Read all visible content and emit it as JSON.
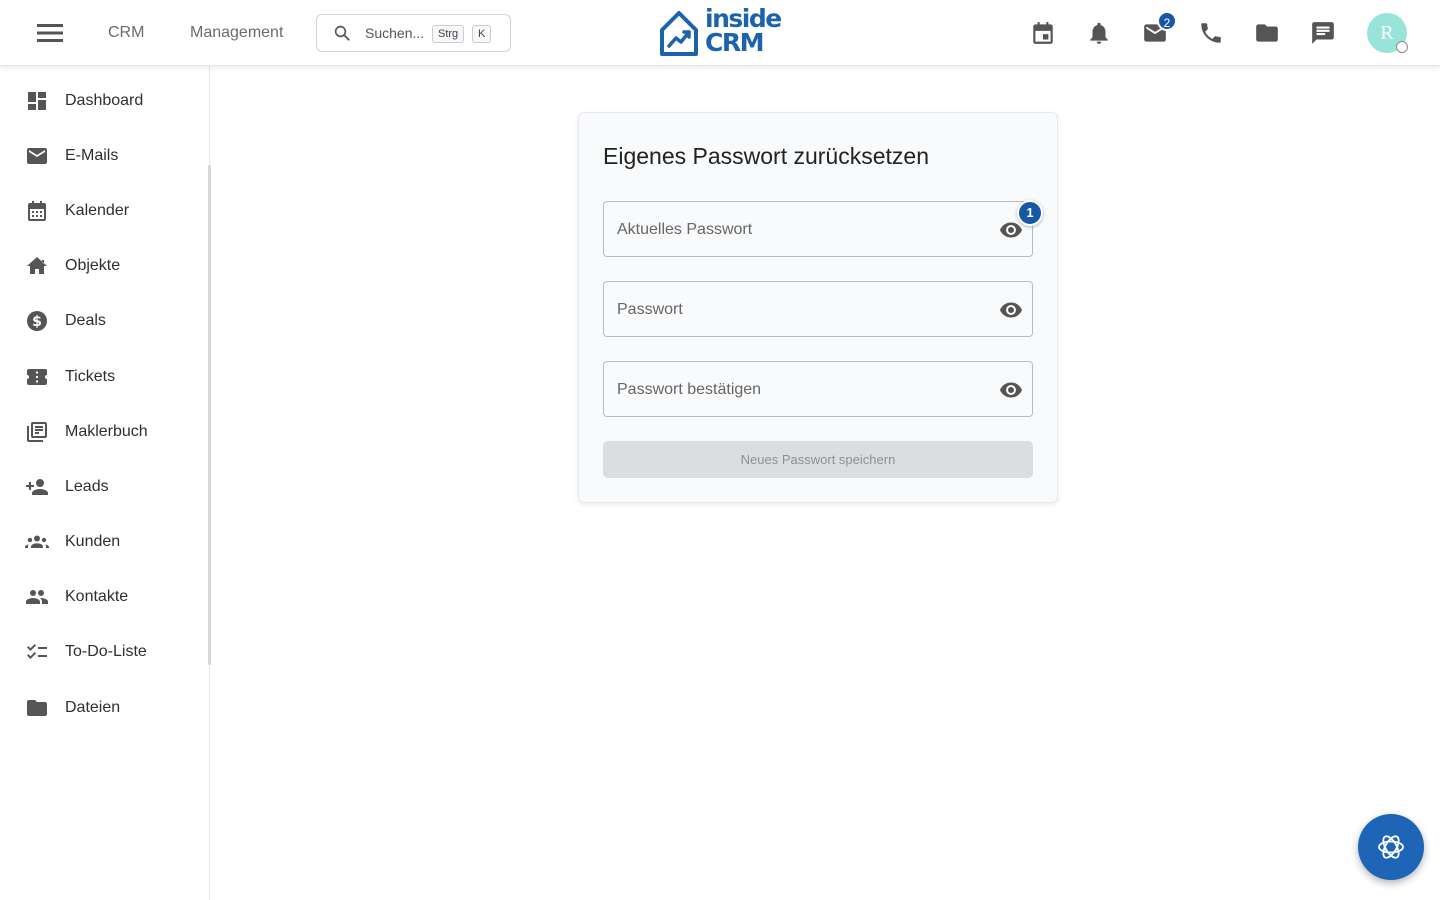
{
  "header": {
    "nav": [
      "CRM",
      "Management"
    ],
    "search": {
      "placeholder": "Suchen...",
      "shortcut_keys": [
        "Strg",
        "K"
      ]
    },
    "logo": {
      "line1": "inside",
      "line2": "CRM",
      "color": "#1b63ad"
    },
    "icons": [
      "calendar-icon",
      "bell-icon",
      "mail-icon",
      "phone-icon",
      "folder-icon",
      "chat-icon"
    ],
    "mail_badge": "2",
    "avatar": {
      "initial": "R",
      "color": "#98e3da"
    }
  },
  "sidebar": {
    "items": [
      {
        "label": "Dashboard",
        "icon": "dashboard-icon"
      },
      {
        "label": "E-Mails",
        "icon": "mail-icon"
      },
      {
        "label": "Kalender",
        "icon": "calendar-icon"
      },
      {
        "label": "Objekte",
        "icon": "home-icon"
      },
      {
        "label": "Deals",
        "icon": "dollar-icon"
      },
      {
        "label": "Tickets",
        "icon": "ticket-icon"
      },
      {
        "label": "Maklerbuch",
        "icon": "library-icon"
      },
      {
        "label": "Leads",
        "icon": "person-add-icon"
      },
      {
        "label": "Kunden",
        "icon": "groups-icon"
      },
      {
        "label": "Kontakte",
        "icon": "people-icon"
      },
      {
        "label": "To-Do-Liste",
        "icon": "checklist-icon"
      },
      {
        "label": "Dateien",
        "icon": "folder-icon"
      }
    ]
  },
  "card": {
    "title": "Eigenes Passwort zurücksetzen",
    "fields": [
      {
        "placeholder": "Aktuelles Passwort"
      },
      {
        "placeholder": "Passwort"
      },
      {
        "placeholder": "Passwort bestätigen"
      }
    ],
    "field_badge": "1",
    "save_label": "Neues Passwort speichern"
  },
  "colors": {
    "accent": "#1857a4",
    "fab": "#1e64b7"
  }
}
